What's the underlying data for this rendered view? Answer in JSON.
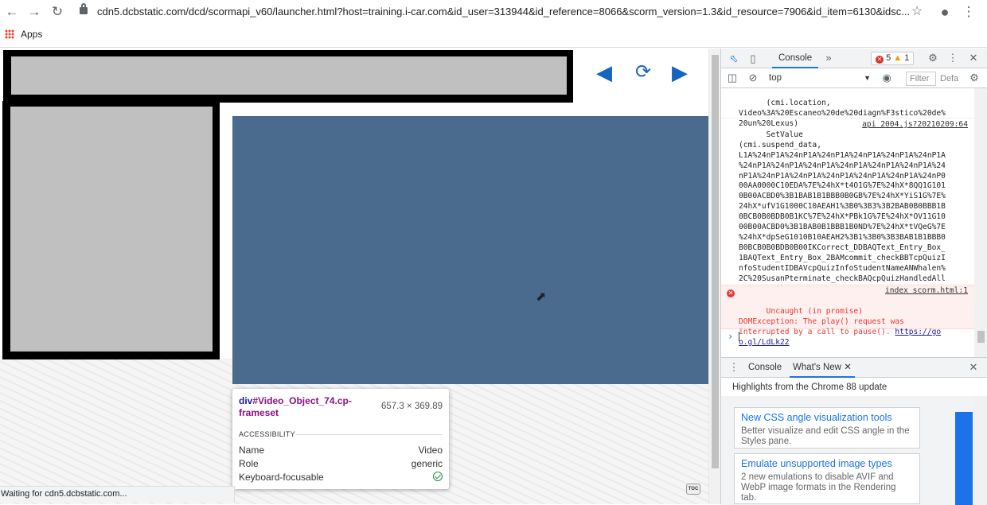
{
  "browser": {
    "url": "cdn5.dcbstatic.com/dcd/scormapi_v60/launcher.html?host=training.i-car.com&id_user=313944&id_reference=8066&scorm_version=1.3&id_resource=7906&id_item=6130&idsc...",
    "bookmarks_label": "Apps",
    "status_text": "Waiting for cdn5.dcbstatic.com..."
  },
  "page": {
    "toc_label": "TOC"
  },
  "tooltip": {
    "selector_tag": "div",
    "selector_rest": "#Video_Object_74.cp-frameset",
    "dimensions": "657.3 × 369.89",
    "section_title": "ACCESSIBILITY",
    "rows": [
      {
        "label": "Name",
        "value": "Video"
      },
      {
        "label": "Role",
        "value": "generic"
      },
      {
        "label": "Keyboard-focusable",
        "value": ""
      }
    ]
  },
  "devtools": {
    "tab_console": "Console",
    "more_tabs": "»",
    "error_count": "5",
    "warning_count": "1",
    "context": "top",
    "filter_placeholder": "Filter",
    "levels": "Defa",
    "messages": [
      {
        "text": "(cmi.location,\nVideo%3A%20Escaneo%20de%20diagn%F3stico%20de%\n20un%20Lexus)",
        "source": ""
      },
      {
        "text": "SetValue\n(cmi.suspend_data,\nL1A%24nP1A%24nP1A%24nP1A%24nP1A%24nP1A%24nP1A\n%24nP1A%24nP1A%24nP1A%24nP1A%24nP1A%24nP1A%24\nnP1A%24nP1A%24nP1A%24nP1A%24nP1A%24nP1A%24nP0\n00AA0000C10EDA%7E%24hX*t4O1G%7E%24hX*8QQ1G101\n0B00ACBD0%3B1BAB1B1BBB0B0GB%7E%24hX*YiS1G%7E%\n24hX*ufV1G1000C10AEAH1%3B0%3B3%3B2BAB0B0BBB1B\n0BCB0B0BDB0B1KC%7E%24hX*PBk1G%7E%24hX*OV11G10\n00B00ACBD0%3B1BAB0B1BBB1B0ND%7E%24hX*tVQeG%7E\n%24hX*dpSeG1010B10AEAH2%3B1%3B0%3B3BAB1B1BBB0\nB0BCB0B0BDB0B00IKCorrect_DDBAQText_Entry_Box_\n1BAQText_Entry_Box_2BAMcommit_checkBBTcpQuizI\nnfoStudentIDBAVcpQuizInfoStudentNameANWhalen%\n2C%20SusanPterminate_checkBAQcpQuizHandledAll\nBA$_#-#_$)",
        "source": "api 2004.js?20210209:64"
      },
      {
        "text": "Uncaught (in promise)\nDOMException: The play() request was\ninterrupted by a call to pause(). ",
        "link": "https://go\no.gl/LdLk22",
        "source": "index scorm.html:1"
      }
    ],
    "drawer_tab_console": "Console",
    "drawer_tab_whatsnew": "What's New",
    "highlights": "Highlights from the Chrome 88 update",
    "cards": [
      {
        "title": "New CSS angle visualization tools",
        "desc": "Better visualize and edit CSS angle in the Styles pane."
      },
      {
        "title": "Emulate unsupported image types",
        "desc": "2 new emulations to disable AVIF and WebP image formats in the Rendering tab."
      }
    ]
  },
  "colors": {
    "video_bg": "#4a6b8e",
    "nav_arrow": "#1565c0",
    "devtools_accent": "#1a73e8",
    "error_red": "#e53935"
  }
}
